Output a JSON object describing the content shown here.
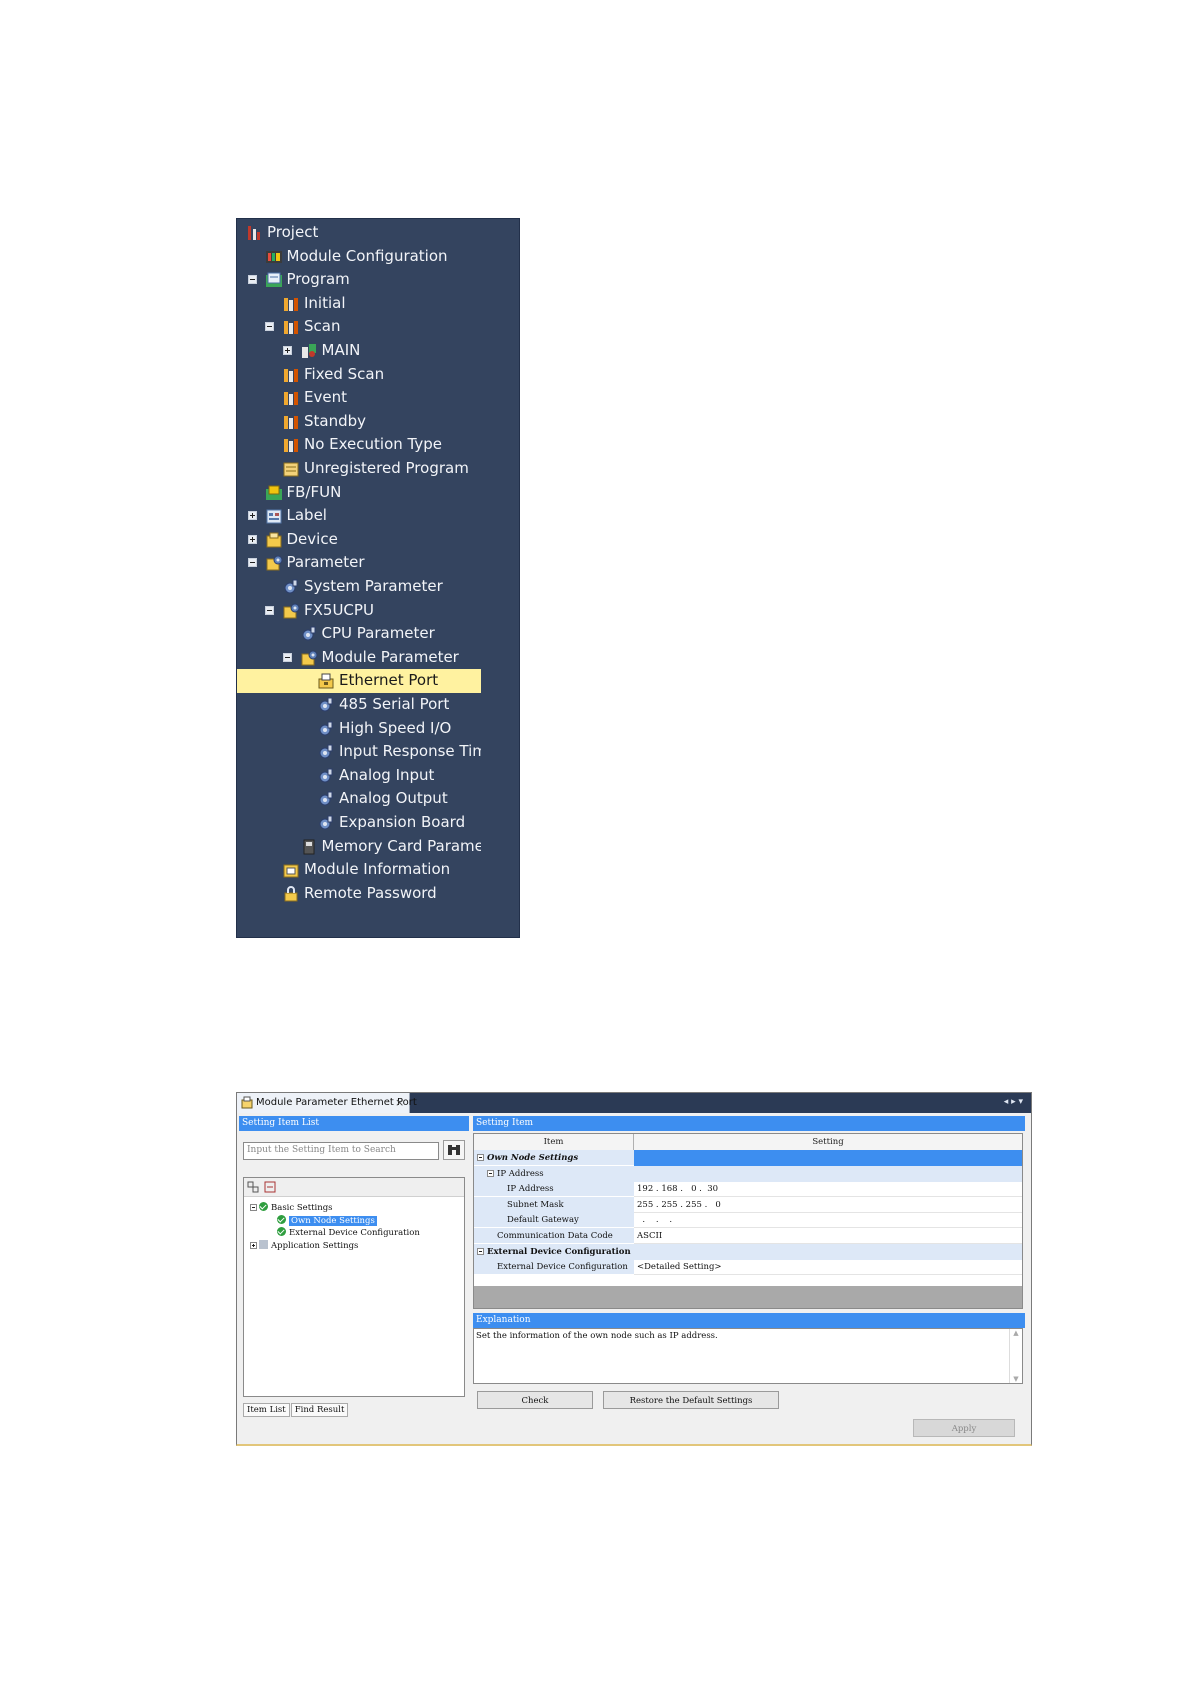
{
  "project_tree": {
    "items": [
      {
        "label": "Project",
        "icon": "project-icon",
        "depth": 0,
        "expander": "none"
      },
      {
        "label": "Module Configuration",
        "icon": "module-configuration-icon",
        "depth": 1,
        "expander": "none"
      },
      {
        "label": "Program",
        "icon": "program-icon",
        "depth": 1,
        "expander": "minus"
      },
      {
        "label": "Initial",
        "icon": "program-folder-icon",
        "depth": 2,
        "expander": "none"
      },
      {
        "label": "Scan",
        "icon": "program-folder-icon",
        "depth": 2,
        "expander": "minus"
      },
      {
        "label": "MAIN",
        "icon": "program-block-icon",
        "depth": 3,
        "expander": "plus"
      },
      {
        "label": "Fixed Scan",
        "icon": "program-folder-icon",
        "depth": 2,
        "expander": "none"
      },
      {
        "label": "Event",
        "icon": "program-folder-icon",
        "depth": 2,
        "expander": "none"
      },
      {
        "label": "Standby",
        "icon": "program-folder-icon",
        "depth": 2,
        "expander": "none"
      },
      {
        "label": "No Execution Type",
        "icon": "program-folder-icon",
        "depth": 2,
        "expander": "none"
      },
      {
        "label": "Unregistered Program",
        "icon": "unregistered-program-icon",
        "depth": 2,
        "expander": "none"
      },
      {
        "label": "FB/FUN",
        "icon": "fb-fun-icon",
        "depth": 1,
        "expander": "none"
      },
      {
        "label": "Label",
        "icon": "label-icon",
        "depth": 1,
        "expander": "plus"
      },
      {
        "label": "Device",
        "icon": "device-icon",
        "depth": 1,
        "expander": "plus"
      },
      {
        "label": "Parameter",
        "icon": "parameter-icon",
        "depth": 1,
        "expander": "minus"
      },
      {
        "label": "System Parameter",
        "icon": "parameter-item-icon",
        "depth": 2,
        "expander": "none"
      },
      {
        "label": "FX5UCPU",
        "icon": "parameter-icon",
        "depth": 2,
        "expander": "minus"
      },
      {
        "label": "CPU Parameter",
        "icon": "parameter-item-icon",
        "depth": 3,
        "expander": "none"
      },
      {
        "label": "Module Parameter",
        "icon": "parameter-icon",
        "depth": 3,
        "expander": "minus"
      },
      {
        "label": "Ethernet Port",
        "icon": "ethernet-port-icon",
        "depth": 4,
        "expander": "none",
        "selected": true
      },
      {
        "label": "485 Serial Port",
        "icon": "parameter-item-icon",
        "depth": 4,
        "expander": "none"
      },
      {
        "label": "High Speed I/O",
        "icon": "parameter-item-icon",
        "depth": 4,
        "expander": "none"
      },
      {
        "label": "Input Response Time",
        "icon": "parameter-item-icon",
        "depth": 4,
        "expander": "none"
      },
      {
        "label": "Analog Input",
        "icon": "parameter-item-icon",
        "depth": 4,
        "expander": "none"
      },
      {
        "label": "Analog Output",
        "icon": "parameter-item-icon",
        "depth": 4,
        "expander": "none"
      },
      {
        "label": "Expansion Board",
        "icon": "parameter-item-icon",
        "depth": 4,
        "expander": "none"
      },
      {
        "label": "Memory Card Parameter",
        "icon": "memory-card-icon",
        "depth": 3,
        "expander": "none"
      },
      {
        "label": "Module Information",
        "icon": "module-information-icon",
        "depth": 2,
        "expander": "none"
      },
      {
        "label": "Remote Password",
        "icon": "remote-password-icon",
        "depth": 2,
        "expander": "none"
      }
    ]
  },
  "module_window": {
    "tab_label": "Module Parameter Ethernet Port",
    "tab_close": "×",
    "tab_nav": "◂ ▸ ▾",
    "setting_item_list_title": "Setting Item List",
    "search_placeholder": "Input the Setting Item to Search",
    "left_tree": [
      {
        "label": "Basic Settings",
        "expander": "minus",
        "check": true,
        "indent": 0
      },
      {
        "label": "Own Node Settings",
        "expander": "none",
        "check": true,
        "indent": 1,
        "selected": true
      },
      {
        "label": "External Device Configuration",
        "expander": "none",
        "check": true,
        "indent": 1
      },
      {
        "label": "Application Settings",
        "expander": "plus",
        "check": false,
        "indent": 0
      }
    ],
    "bottom_tabs": [
      "Item List",
      "Find Result"
    ],
    "setting_item_title": "Setting Item",
    "grid_headers": {
      "item": "Item",
      "setting": "Setting"
    },
    "grid_rows": [
      {
        "item": "Own Node Settings",
        "setting": "",
        "style": "group",
        "indent": 0
      },
      {
        "item": "IP Address",
        "setting": "",
        "style": "subgroup",
        "indent": 1
      },
      {
        "item": "IP Address",
        "setting": "192 . 168 .   0 .  30",
        "style": "row",
        "indent": 3
      },
      {
        "item": "Subnet Mask",
        "setting": "255 . 255 . 255 .   0",
        "style": "row",
        "indent": 3
      },
      {
        "item": "Default Gateway",
        "setting": "  .    .    .",
        "style": "row",
        "indent": 3
      },
      {
        "item": "Communication Data Code",
        "setting": "ASCII",
        "style": "row",
        "indent": 2
      },
      {
        "item": "External Device Configuration",
        "setting": "",
        "style": "group2",
        "indent": 0
      },
      {
        "item": "External Device Configuration",
        "setting": "<Detailed Setting>",
        "style": "row",
        "indent": 2
      }
    ],
    "explanation_title": "Explanation",
    "explanation_text": "Set the information of the own node such as IP address.",
    "check_button": "Check",
    "restore_button": "Restore the Default Settings",
    "apply_button": "Apply"
  }
}
